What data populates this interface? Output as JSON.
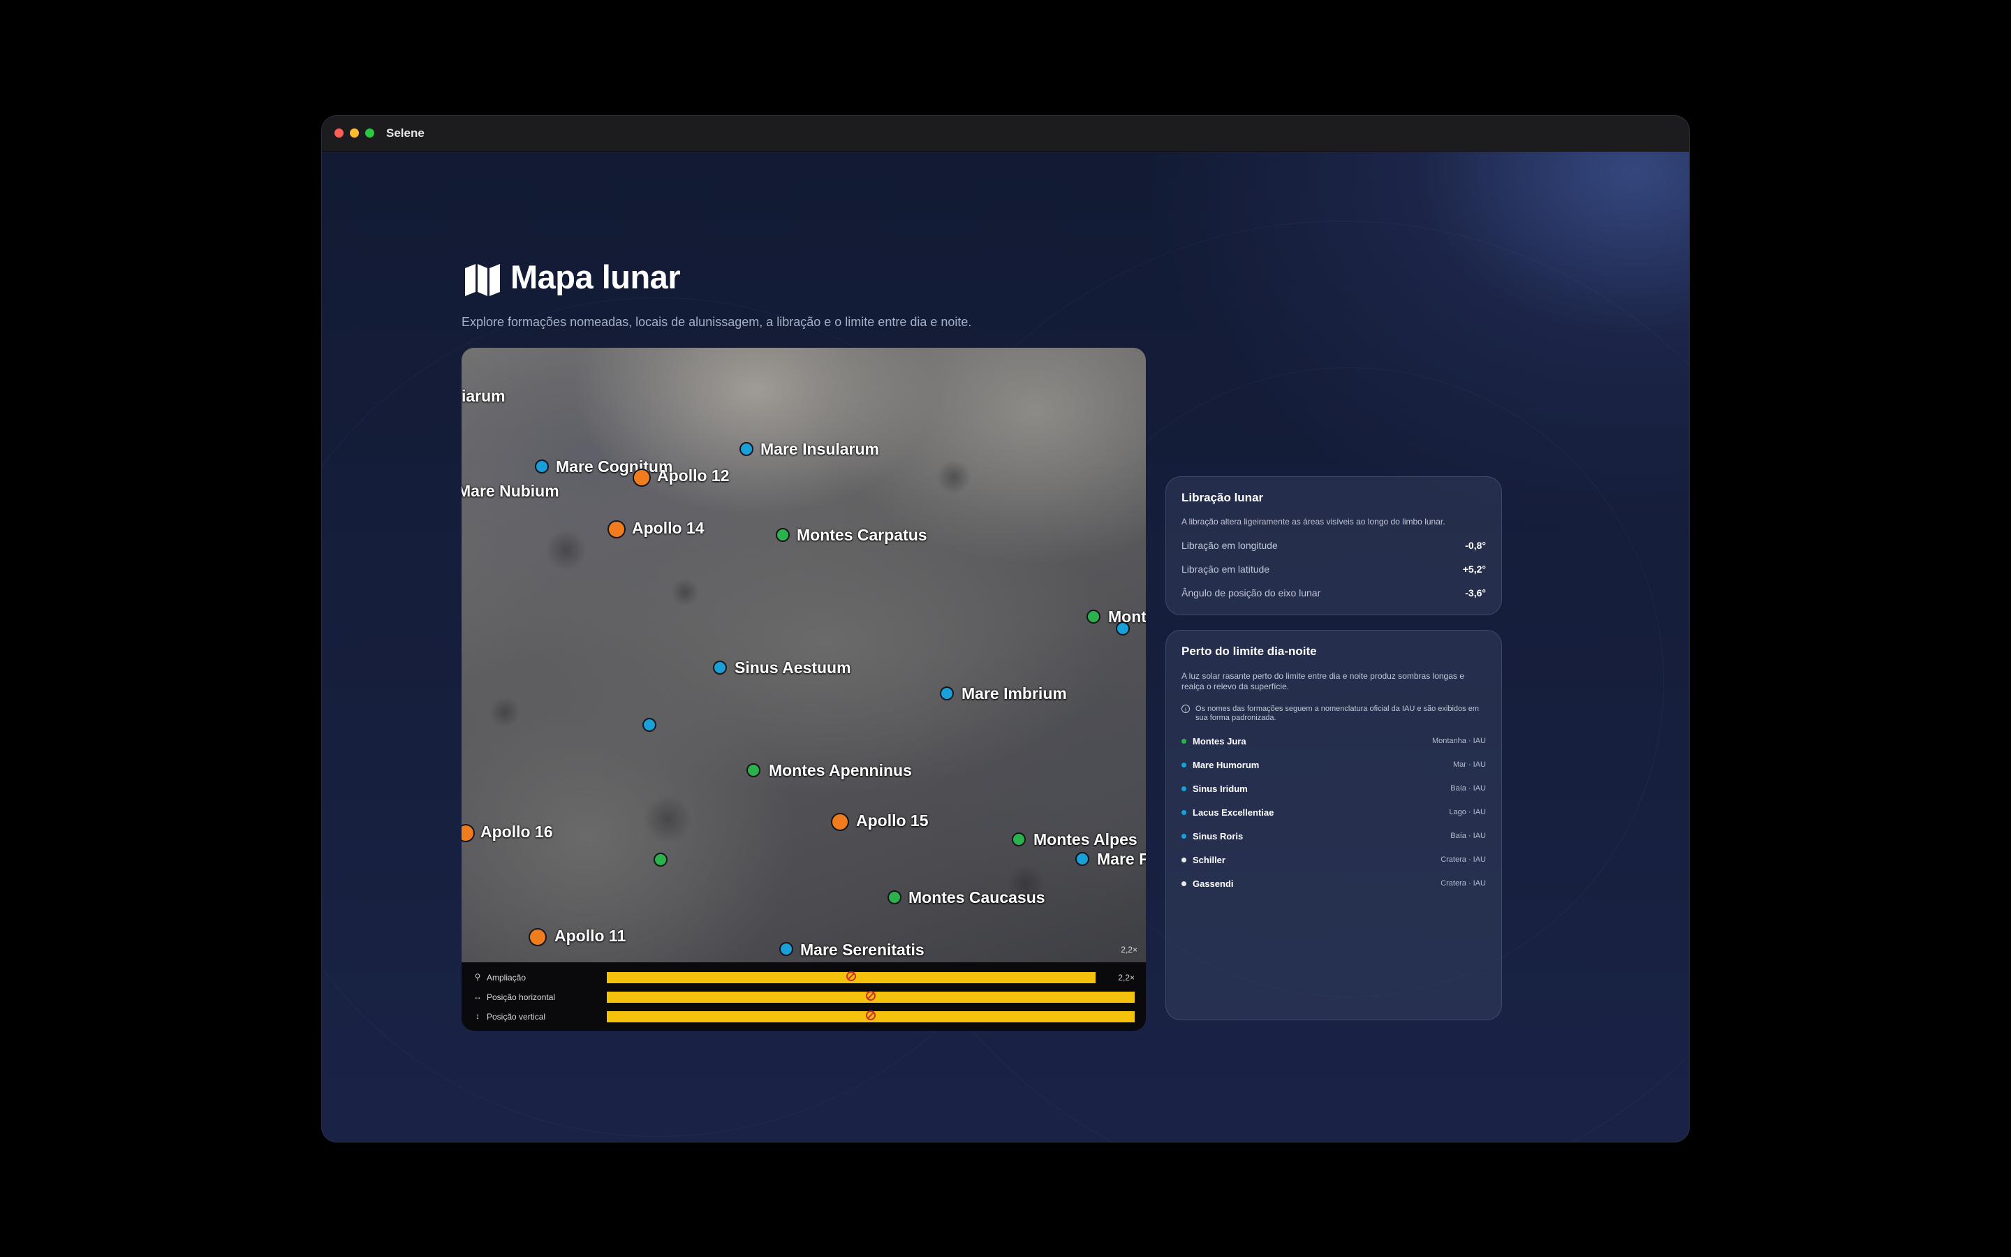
{
  "window": {
    "title": "Selene"
  },
  "header": {
    "title": "Mapa lunar",
    "subtitle": "Explore formações nomeadas, locais de alunissagem, a libração e o limite entre dia e noite."
  },
  "map": {
    "zoom_badge": "2,2×",
    "labels": {
      "humorum_partial": "iarum",
      "mare_cognitum": "Mare Cognitum",
      "apollo_12": "Apollo 12",
      "mare_insularum": "Mare Insularum",
      "mare_nubium": "Mare Nubium",
      "apollo_14": "Apollo 14",
      "montes_carpatus": "Montes Carpatus",
      "montes_partial": "Mont",
      "sinus_aestuum": "Sinus Aestuum",
      "mare_imbrium": "Mare Imbrium",
      "montes_apenninus": "Montes Apenninus",
      "apollo_16": "Apollo 16",
      "apollo_15": "Apollo 15",
      "montes_alpes": "Montes Alpes",
      "mare_partial": "Mare F",
      "montes_caucasus": "Montes Caucasus",
      "apollo_11": "Apollo 11",
      "mare_serenitatis": "Mare Serenitatis"
    },
    "controls": [
      {
        "label": "Ampliação",
        "value": "2,2×",
        "fraction": 0.5
      },
      {
        "label": "Posição horizontal",
        "value": "",
        "fraction": 0.5
      },
      {
        "label": "Posição vertical",
        "value": "",
        "fraction": 0.5
      }
    ]
  },
  "libration": {
    "title": "Libração lunar",
    "description": "A libração altera ligeiramente as áreas visíveis ao longo do limbo lunar.",
    "rows": [
      {
        "label": "Libração em longitude",
        "value": "-0,8°"
      },
      {
        "label": "Libração em latitude",
        "value": "+5,2°"
      },
      {
        "label": "Ângulo de posição do eixo lunar",
        "value": "-3,6°"
      }
    ]
  },
  "terminator": {
    "title": "Perto do limite dia-noite",
    "description": "A luz solar rasante perto do limite entre dia e noite produz sombras longas e realça o relevo da superfície.",
    "note": "Os nomes das formações seguem a nomenclatura oficial da IAU e são exibidos em sua forma padronizada.",
    "features": [
      {
        "name": "Montes Jura",
        "type": "Montanha · IAU",
        "color": "#2bb24c"
      },
      {
        "name": "Mare Humorum",
        "type": "Mar · IAU",
        "color": "#1aa0d8"
      },
      {
        "name": "Sinus Iridum",
        "type": "Baía · IAU",
        "color": "#1aa0d8"
      },
      {
        "name": "Lacus Excellentiae",
        "type": "Lago · IAU",
        "color": "#1aa0d8"
      },
      {
        "name": "Sinus Roris",
        "type": "Baía · IAU",
        "color": "#1aa0d8"
      },
      {
        "name": "Schiller",
        "type": "Cratera · IAU",
        "color": "#e8e8ee"
      },
      {
        "name": "Gassendi",
        "type": "Cratera · IAU",
        "color": "#e8e8ee"
      }
    ]
  },
  "colors": {
    "sea": "#1aa0d8",
    "mountain": "#2bb24c",
    "landing": "#f07c1e",
    "slider": "#f4c20d"
  }
}
